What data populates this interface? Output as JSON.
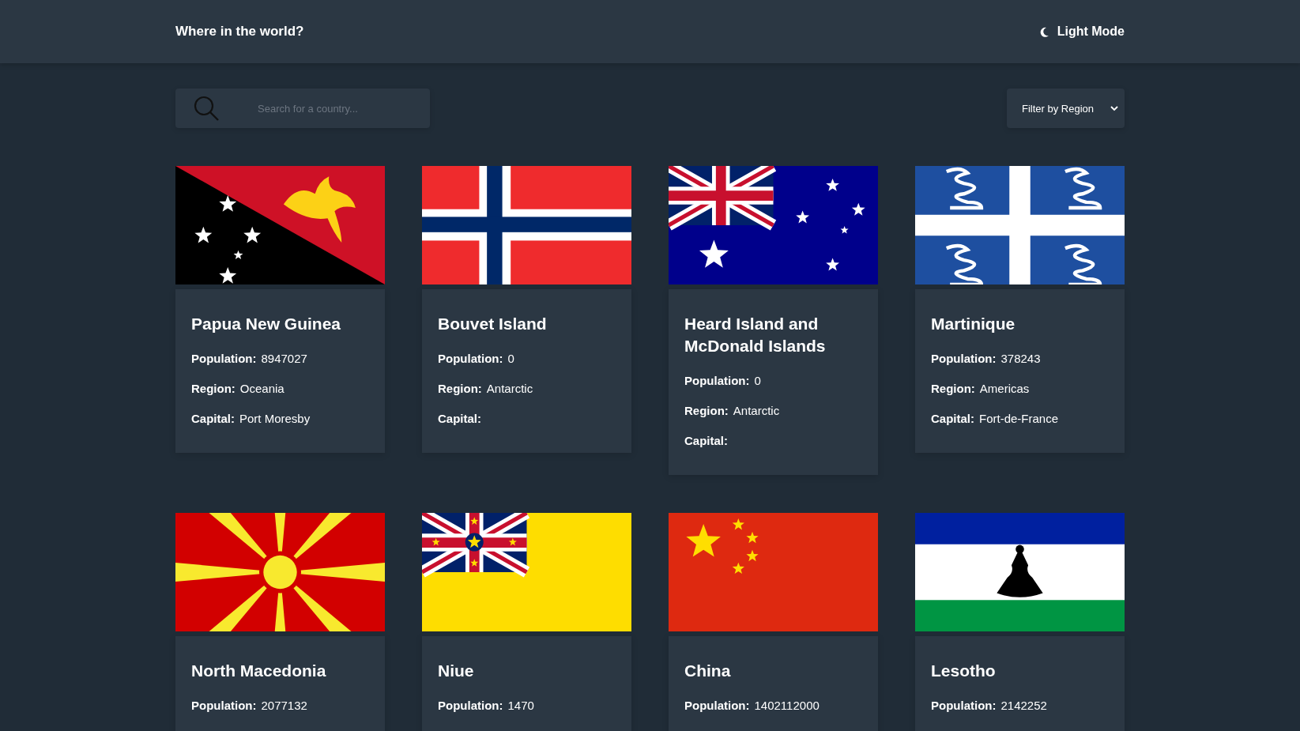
{
  "header": {
    "title": "Where in the world?",
    "mode_toggle": "Light Mode"
  },
  "search": {
    "placeholder": "Search for a country..."
  },
  "filter": {
    "label": "Filter by Region"
  },
  "countries": [
    {
      "name": "Papua New Guinea",
      "kind": "pg",
      "fields": [
        {
          "label": "Population:",
          "value": "8947027"
        },
        {
          "label": "Region:",
          "value": "Oceania"
        },
        {
          "label": "Capital:",
          "value": "Port Moresby"
        }
      ]
    },
    {
      "name": "Bouvet Island",
      "kind": "bv",
      "fields": [
        {
          "label": "Population:",
          "value": "0"
        },
        {
          "label": "Region:",
          "value": "Antarctic"
        },
        {
          "label": "Capital:"
        }
      ]
    },
    {
      "name": "Heard Island and McDonald Islands",
      "kind": "hm",
      "fields": [
        {
          "label": "Population:",
          "value": "0"
        },
        {
          "label": "Region:",
          "value": "Antarctic"
        },
        {
          "label": "Capital:"
        }
      ]
    },
    {
      "name": "Martinique",
      "kind": "mq",
      "fields": [
        {
          "label": "Population:",
          "value": "378243"
        },
        {
          "label": "Region:",
          "value": "Americas"
        },
        {
          "label": "Capital:",
          "value": "Fort-de-France"
        }
      ]
    },
    {
      "name": "North Macedonia",
      "kind": "mk",
      "fields": [
        {
          "label": "Population:",
          "value": "2077132"
        }
      ]
    },
    {
      "name": "Niue",
      "kind": "nu",
      "fields": [
        {
          "label": "Population:",
          "value": "1470"
        }
      ]
    },
    {
      "name": "China",
      "kind": "cn",
      "fields": [
        {
          "label": "Population:",
          "value": "1402112000"
        }
      ]
    },
    {
      "name": "Lesotho",
      "kind": "ls",
      "fields": [
        {
          "label": "Population:",
          "value": "2142252"
        }
      ]
    }
  ]
}
